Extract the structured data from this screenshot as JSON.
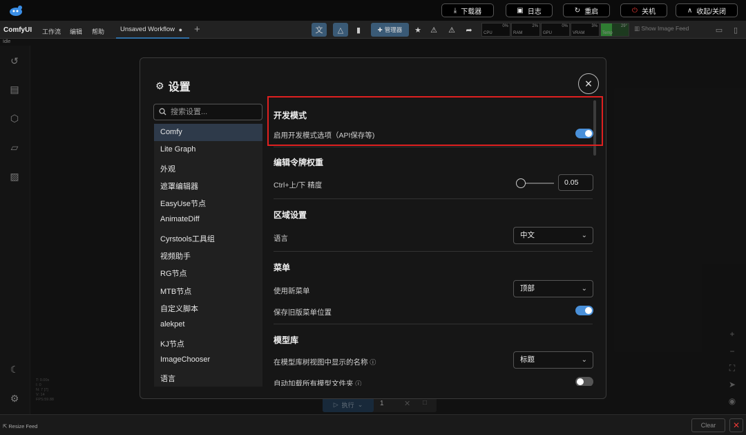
{
  "topbar": {
    "buttons": [
      {
        "label": "下载器",
        "icon": "download-icon"
      },
      {
        "label": "日志",
        "icon": "terminal-icon"
      },
      {
        "label": "重启",
        "icon": "refresh-icon"
      },
      {
        "label": "关机",
        "icon": "power-icon",
        "accent": "#e53935"
      },
      {
        "label": "收起/关闭",
        "icon": "chevron-up-icon"
      }
    ]
  },
  "menubar": {
    "brand": "ComfyUI",
    "items": [
      "工作流",
      "编辑",
      "帮助"
    ],
    "tab_label": "Unsaved Workflow",
    "tab_dot": "●",
    "manager_label": "管理器",
    "monitors": [
      {
        "label": "CPU",
        "value": "0%"
      },
      {
        "label": "RAM",
        "value": "2%"
      },
      {
        "label": "GPU",
        "value": "0%"
      },
      {
        "label": "VRAM",
        "value": "3%"
      },
      {
        "label": "Temp",
        "value": "29°"
      }
    ],
    "show_feed": "Show Image Feed",
    "status": "Idle"
  },
  "stats": [
    "T: 0.00s",
    "I: 0",
    "N: 7 [7]",
    "V: 14",
    "FPS:59.88"
  ],
  "runbar": {
    "run_label": "执行",
    "count": "1"
  },
  "bottombar": {
    "resize_feed": "Resize Feed",
    "clear": "Clear"
  },
  "dialog": {
    "title": "设置",
    "search_placeholder": "搜索设置...",
    "categories": [
      "Comfy",
      "Lite Graph",
      "外观",
      "遮罩编辑器",
      "EasyUse节点",
      "AnimateDiff",
      "Cyrstools工具组",
      "视频助手",
      "RG节点",
      "MTB节点",
      "自定义脚本",
      "alekpet",
      "KJ节点",
      "ImageChooser",
      "语言"
    ],
    "active_category": "Comfy",
    "sections": {
      "dev_mode": {
        "title": "开发模式",
        "row_label": "启用开发模式选项（API保存等)",
        "enabled": true
      },
      "edit_token": {
        "title": "编辑令牌权重",
        "row_label": "Ctrl+上/下 精度",
        "value": "0.05"
      },
      "locale": {
        "title": "区域设置",
        "row_label": "语言",
        "value": "中文"
      },
      "menu": {
        "title": "菜单",
        "row1_label": "使用新菜单",
        "row1_value": "顶部",
        "row2_label": "保存旧版菜单位置",
        "row2_enabled": true
      },
      "model_lib": {
        "title": "模型库",
        "row1_label": "在模型库树视图中显示的名称",
        "row1_value": "标题",
        "row2_label": "自动加载所有模型文件夹",
        "row2_enabled": false
      }
    }
  },
  "colors": {
    "accent": "#4a90d9",
    "highlight": "#e02020",
    "danger": "#e53935"
  }
}
